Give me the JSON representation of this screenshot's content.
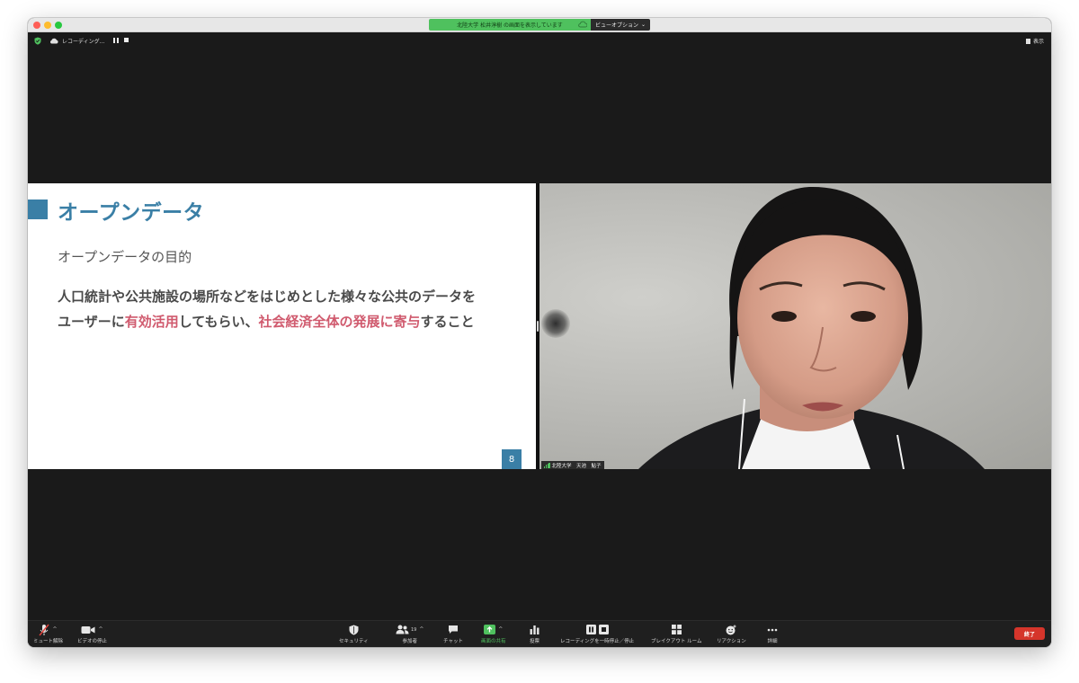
{
  "titlebar": {
    "share_status": "北陸大学 松井淳樹 の画面を表示しています",
    "view_options": "ビューオプション"
  },
  "topbar": {
    "recording_label": "レコーディング...",
    "view_label": "表示"
  },
  "slide": {
    "title": "オープンデータ",
    "subtitle": "オープンデータの目的",
    "body_line1": "人口統計や公共施設の場所などをはじめとした様々な公共のデータを",
    "body_line2_a": "ユーザーに",
    "body_line2_hl1": "有効活用",
    "body_line2_b": "してもらい、",
    "body_line2_hl2": "社会経済全体の発展に寄与",
    "body_line2_c": "すること",
    "page_number": "8",
    "accent_color": "#3a7fa6",
    "highlight_color": "#d05a6e"
  },
  "video": {
    "participant_name": "北陸大学　天池　鮎子"
  },
  "toolbar": {
    "unmute": "ミュート解除",
    "stop_video": "ビデオの停止",
    "security": "セキュリティ",
    "participants": "参加者",
    "participants_count": "19",
    "chat": "チャット",
    "share_screen": "画面の共有",
    "polls": "投票",
    "recording_pause": "レコーディングを一時停止／停止",
    "breakout": "ブレイクアウト ルーム",
    "reactions": "リアクション",
    "more": "詳細",
    "end": "終了",
    "share_color": "#4fc15e",
    "end_color": "#d5352b"
  }
}
